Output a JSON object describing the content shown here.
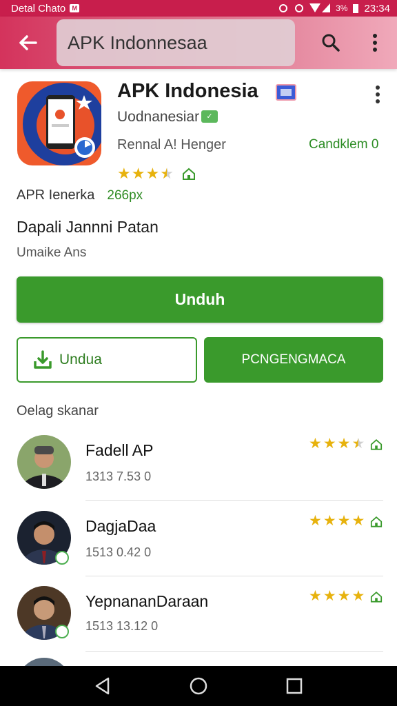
{
  "status_bar": {
    "left_text": "Detal Chato",
    "battery": "3%",
    "time": "23:34"
  },
  "search": {
    "value": "APK Indonnesaa"
  },
  "app": {
    "title": "APK Indonesia",
    "developer": "Uodnanesiar",
    "category": "Rennal A! Henger",
    "candidate": "Candklem 0",
    "rating": 3.5,
    "apr_label": "APR Ienerka",
    "apr_size": "266px",
    "desc_title": "Dapali Jannni Patan",
    "desc_sub": "Umaike Ans"
  },
  "buttons": {
    "primary": "Unduh",
    "outline": "Undua",
    "secondary": "PCNGENGMACA"
  },
  "section": {
    "label": "Oelag skanar"
  },
  "reviews": [
    {
      "name": "Fadell AP",
      "meta": "1313 7.53 0",
      "stars": 3.5
    },
    {
      "name": "DagjaDaa",
      "meta": "1513 0.42 0",
      "stars": 4
    },
    {
      "name": "YepnananDaraan",
      "meta": "1513 13.12 0",
      "stars": 4
    }
  ],
  "colors": {
    "accent": "#c81e4c",
    "primary_green": "#3a9a2c",
    "star": "#e7b20d"
  }
}
